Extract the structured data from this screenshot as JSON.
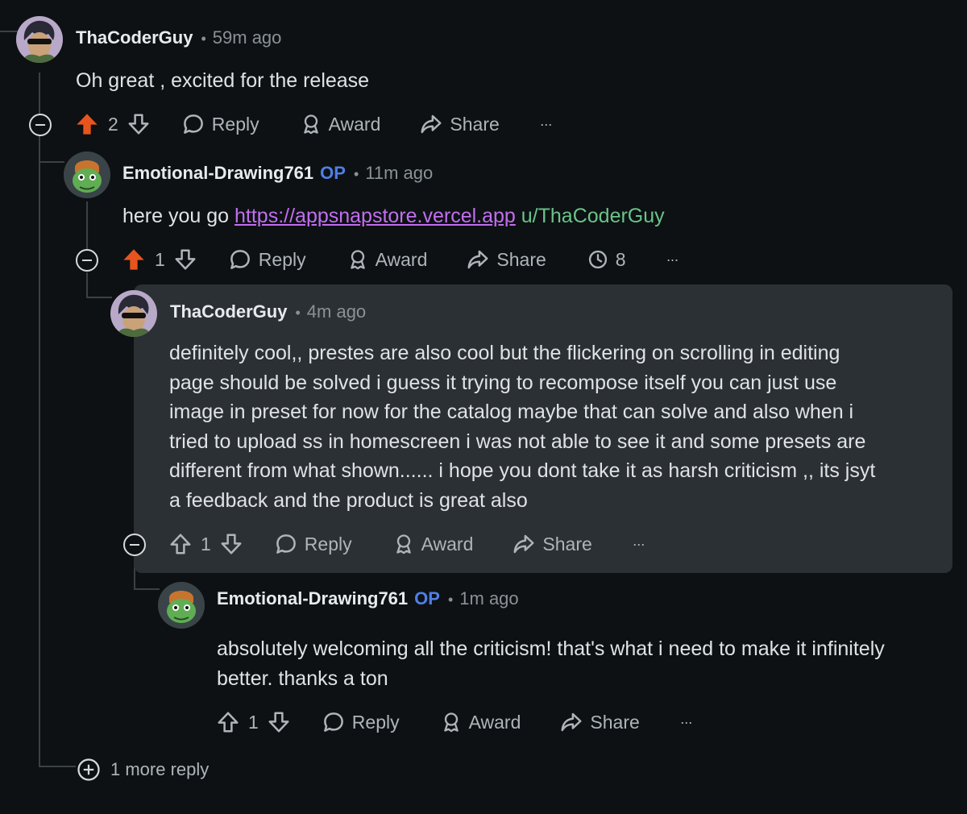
{
  "comments": [
    {
      "user": "ThaCoderGuy",
      "op": "",
      "time": "59m ago",
      "body": "Oh great , excited for the release",
      "votes": "2",
      "upvoted": true,
      "reply": "Reply",
      "award": "Award",
      "share": "Share",
      "more": "···"
    },
    {
      "user": "Emotional-Drawing761",
      "op": "OP",
      "time": "11m ago",
      "body_prefix": "here you go ",
      "link": "https://appsnapstore.vercel.app",
      "mention": "u/ThaCoderGuy",
      "votes": "1",
      "upvoted": true,
      "reply": "Reply",
      "award": "Award",
      "share": "Share",
      "views": "8",
      "more": "···"
    },
    {
      "user": "ThaCoderGuy",
      "op": "",
      "time": "4m ago",
      "body_lines": [
        "definitely cool,, prestes are also cool but the flickering on scrolling in editing",
        "page should be solved i guess it trying to recompose itself you can just use",
        "image in preset for now for the catalog maybe that can solve and also when i",
        "tried to upload ss in homescreen i was not able to see it and some presets are",
        "different from what shown...... i hope you dont take it as harsh criticism ,, its jsyt",
        "a feedback and the product is great also"
      ],
      "votes": "1",
      "upvoted": false,
      "reply": "Reply",
      "award": "Award",
      "share": "Share",
      "more": "···"
    },
    {
      "user": "Emotional-Drawing761",
      "op": "OP",
      "time": "1m ago",
      "body_lines": [
        "absolutely welcoming all the criticism! that's what i need to make it infinitely",
        "better. thanks a ton"
      ],
      "votes": "1",
      "upvoted": false,
      "reply": "Reply",
      "award": "Award",
      "share": "Share",
      "more": "···"
    }
  ],
  "more_replies": "1 more reply",
  "colors": {
    "background": "#0d1113",
    "upvote_active": "#e8541e",
    "op_badge": "#4f7fe6",
    "link": "#c26ef0",
    "mention": "#6ac48a",
    "highlight": "#2b3034"
  },
  "icons": [
    "upvote-icon",
    "downvote-icon",
    "reply-bubble-icon",
    "award-icon",
    "share-icon",
    "views-clock-icon",
    "more-icon",
    "collapse-icon",
    "expand-icon"
  ]
}
